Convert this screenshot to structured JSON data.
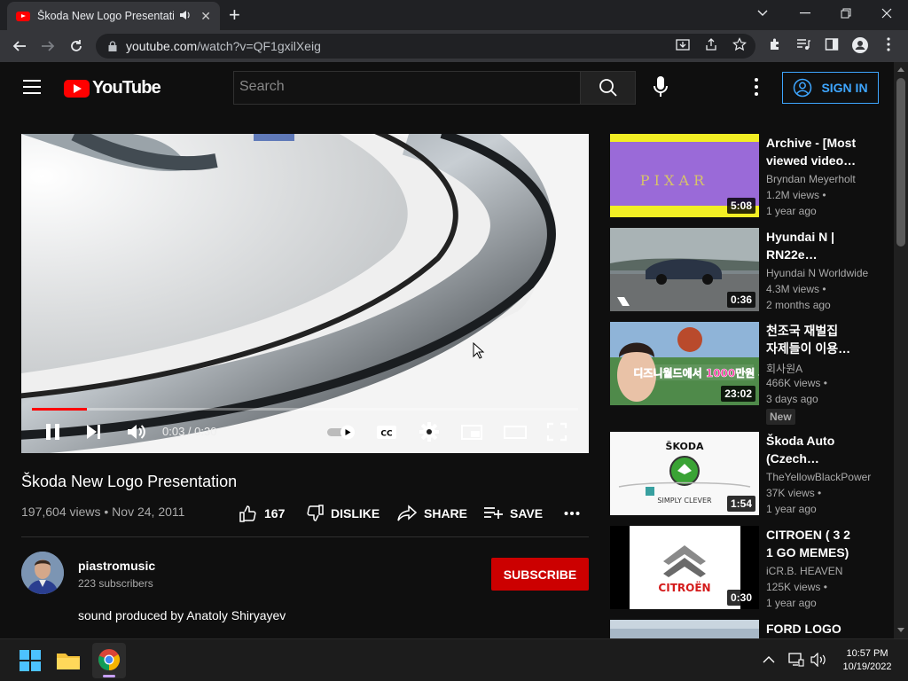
{
  "browser": {
    "tab_title": "Škoda New Logo Presentation",
    "url_host": "youtube.com",
    "url_path": "/watch?v=QF1gxilXeig",
    "new_tab_symbol": "+",
    "tab_close_symbol": "✕"
  },
  "youtube": {
    "logo_text": "YouTube",
    "search_placeholder": "Search",
    "sign_in": "SIGN IN"
  },
  "player": {
    "current_time": "0:03",
    "duration": "0:30",
    "time_display": "0:03 / 0:30",
    "progress_percent": 10
  },
  "video": {
    "title": "Škoda New Logo Presentation",
    "meta": "197,604 views • Nov 24, 2011",
    "likes": "167",
    "dislike_label": "DISLIKE",
    "share_label": "SHARE",
    "save_label": "SAVE"
  },
  "channel": {
    "name": "piastromusic",
    "subscribers": "223 subscribers",
    "subscribe_label": "SUBSCRIBE",
    "description": "sound produced by Anatoly Shiryayev"
  },
  "recommendations": [
    {
      "title_line1": "Archive - [Most",
      "title_line2": "viewed video…",
      "channel": "Bryndan Meyerholt",
      "views": "1.2M views •",
      "age": "1 year ago",
      "duration": "5:08",
      "thumb_text": "P I X A R"
    },
    {
      "title_line1": "Hyundai N |",
      "title_line2": "RN22e…",
      "channel": "Hyundai N Worldwide",
      "views": "4.3M views •",
      "age": "2 months ago",
      "duration": "0:36",
      "thumb_text": ""
    },
    {
      "title_line1": "천조국 재벌집",
      "title_line2": "자제들이 이용…",
      "channel": "회사원A",
      "views": "466K views •",
      "age": "3 days ago",
      "duration": "23:02",
      "badge": "New",
      "thumb_text": "디즈니월드에서 1000만원 써봄"
    },
    {
      "title_line1": "Škoda Auto",
      "title_line2": "(Czech…",
      "channel": "TheYellowBlackPower",
      "views": "37K views •",
      "age": "1 year ago",
      "duration": "1:54",
      "thumb_text_top": "ŠKODA",
      "thumb_text_bottom": "SIMPLY CLEVER"
    },
    {
      "title_line1": "CITROEN ( 3 2",
      "title_line2": "1 GO MEMES)",
      "channel": "iCR.B. HEAVEN",
      "views": "125K views •",
      "age": "1 year ago",
      "duration": "0:30",
      "thumb_text": "CITROËN"
    },
    {
      "title_line1": "FORD LOGO",
      "title_line2": "",
      "channel": "",
      "views": "",
      "age": "",
      "duration": ""
    }
  ],
  "taskbar": {
    "time": "10:57 PM",
    "date": "10/19/2022"
  },
  "colors": {
    "youtube_red": "#ff0000",
    "subscribe_red": "#cc0000",
    "link_blue": "#3ea6ff",
    "page_bg": "#0f0f0f"
  }
}
